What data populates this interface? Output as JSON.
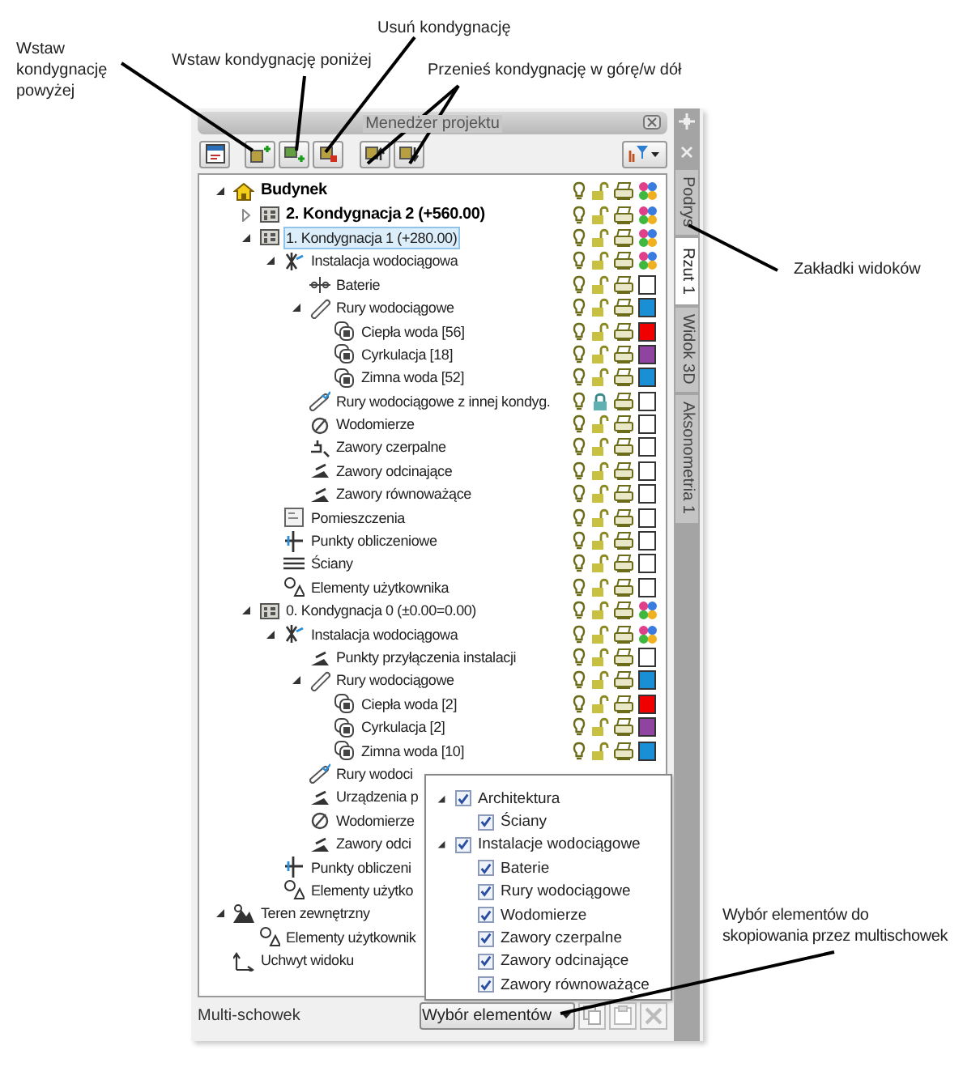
{
  "annotations": [
    {
      "lines": [
        "Wstaw",
        "kondygnację",
        "powyżej"
      ]
    },
    {
      "lines": [
        "Wstaw kondygnację poniżej"
      ]
    },
    {
      "lines": [
        "Usuń kondygnację"
      ]
    },
    {
      "lines": [
        "Przenieś kondygnację w górę/w dół"
      ]
    },
    {
      "lines": [
        "Zakładki widoków"
      ]
    },
    {
      "lines": [
        "Wybór elementów do",
        "skopiowania przez multischowek"
      ]
    }
  ],
  "panel": {
    "title": "Menedżer projektu"
  },
  "view_tabs": [
    {
      "label": "Podrys",
      "selected": false
    },
    {
      "label": "Rzut 1",
      "selected": true
    },
    {
      "label": "Widok 3D",
      "selected": false
    },
    {
      "label": "Aksonometria 1",
      "selected": false
    }
  ],
  "tree": [
    {
      "label": "Budynek",
      "kind": "building",
      "bold": true,
      "selected": false,
      "expanded": true,
      "status": {
        "locked": false,
        "multicolor": true
      },
      "children": [
        {
          "label": "2. Kondygnacja 2 (+560.00)",
          "kind": "floor",
          "bold": true,
          "selected": false,
          "expanded": false,
          "status": {
            "locked": false,
            "multicolor": true
          }
        },
        {
          "label": "1. Kondygnacja 1 (+280.00)",
          "kind": "floor",
          "selected": true,
          "expanded": true,
          "status": {
            "locked": false,
            "multicolor": true
          },
          "children": [
            {
              "label": "Instalacja wodociągowa",
              "kind": "installation",
              "selected": false,
              "expanded": true,
              "status": {
                "locked": false,
                "multicolor": true
              },
              "children": [
                {
                  "label": "Baterie",
                  "kind": "fixture",
                  "selected": false,
                  "status": {
                    "locked": false,
                    "color": "#ffffff"
                  }
                },
                {
                  "label": "Rury wodociągowe",
                  "kind": "pipes",
                  "selected": false,
                  "expanded": true,
                  "status": {
                    "locked": false,
                    "color": "#1b8fd6"
                  },
                  "children": [
                    {
                      "label": "Ciepła woda [56]",
                      "kind": "pipe-group",
                      "selected": false,
                      "status": {
                        "locked": false,
                        "color": "#f00000"
                      }
                    },
                    {
                      "label": "Cyrkulacja [18]",
                      "kind": "pipe-group",
                      "selected": false,
                      "status": {
                        "locked": false,
                        "color": "#8e44a0"
                      }
                    },
                    {
                      "label": "Zimna woda [52]",
                      "kind": "pipe-group",
                      "selected": false,
                      "status": {
                        "locked": false,
                        "color": "#1b8fd6"
                      }
                    }
                  ]
                },
                {
                  "label": "Rury wodociągowe z innej kondyg.",
                  "kind": "pipes-other",
                  "selected": false,
                  "status": {
                    "locked": true,
                    "color": "#ffffff"
                  }
                },
                {
                  "label": "Wodomierze",
                  "kind": "meter",
                  "selected": false,
                  "status": {
                    "locked": false,
                    "color": "#ffffff"
                  }
                },
                {
                  "label": "Zawory czerpalne",
                  "kind": "tap",
                  "selected": false,
                  "status": {
                    "locked": false,
                    "color": "#ffffff"
                  }
                },
                {
                  "label": "Zawory odcinające",
                  "kind": "valve",
                  "selected": false,
                  "status": {
                    "locked": false,
                    "color": "#ffffff"
                  }
                },
                {
                  "label": "Zawory równoważące",
                  "kind": "valve",
                  "selected": false,
                  "status": {
                    "locked": false,
                    "color": "#ffffff"
                  }
                }
              ]
            },
            {
              "label": "Pomieszczenia",
              "kind": "room",
              "selected": false,
              "status": {
                "locked": false,
                "color": "#ffffff"
              }
            },
            {
              "label": "Punkty obliczeniowe",
              "kind": "points",
              "selected": false,
              "status": {
                "locked": false,
                "color": "#ffffff"
              }
            },
            {
              "label": "Ściany",
              "kind": "walls",
              "selected": false,
              "status": {
                "locked": false,
                "color": "#ffffff"
              }
            },
            {
              "label": "Elementy użytkownika",
              "kind": "user-elements",
              "selected": false,
              "status": {
                "locked": false,
                "color": "#ffffff"
              }
            }
          ]
        },
        {
          "label": "0. Kondygnacja 0 (±0.00=0.00)",
          "kind": "floor",
          "selected": false,
          "expanded": true,
          "status": {
            "locked": false,
            "multicolor": true
          },
          "children": [
            {
              "label": "Instalacja wodociągowa",
              "kind": "installation",
              "selected": false,
              "expanded": true,
              "status": {
                "locked": false,
                "multicolor": true
              },
              "children": [
                {
                  "label": "Punkty przyłączenia instalacji",
                  "kind": "valve",
                  "selected": false,
                  "status": {
                    "locked": false,
                    "color": "#ffffff"
                  }
                },
                {
                  "label": "Rury wodociągowe",
                  "kind": "pipes",
                  "selected": false,
                  "expanded": true,
                  "status": {
                    "locked": false,
                    "color": "#1b8fd6"
                  },
                  "children": [
                    {
                      "label": "Ciepła woda [2]",
                      "kind": "pipe-group",
                      "selected": false,
                      "status": {
                        "locked": false,
                        "color": "#f00000"
                      }
                    },
                    {
                      "label": "Cyrkulacja [2]",
                      "kind": "pipe-group",
                      "selected": false,
                      "status": {
                        "locked": false,
                        "color": "#8e44a0"
                      }
                    },
                    {
                      "label": "Zimna woda [10]",
                      "kind": "pipe-group",
                      "selected": false,
                      "status": {
                        "locked": false,
                        "color": "#1b8fd6"
                      }
                    }
                  ]
                },
                {
                  "label": "Rury wodoci",
                  "kind": "pipes-other",
                  "selected": false
                },
                {
                  "label": "Urządzenia p",
                  "kind": "valve",
                  "selected": false
                },
                {
                  "label": "Wodomierze",
                  "kind": "meter",
                  "selected": false
                },
                {
                  "label": "Zawory odci",
                  "kind": "valve",
                  "selected": false
                }
              ]
            },
            {
              "label": "Punkty obliczeni",
              "kind": "points",
              "selected": false
            },
            {
              "label": "Elementy użytko",
              "kind": "user-elements",
              "selected": false
            }
          ]
        }
      ]
    },
    {
      "label": "Teren zewnętrzny",
      "kind": "terrain",
      "selected": false,
      "expanded": true,
      "children": [
        {
          "label": "Elementy użytkownik",
          "kind": "user-elements",
          "selected": false
        }
      ]
    },
    {
      "label": "Uchwyt widoku",
      "kind": "view-handle",
      "selected": false
    }
  ],
  "element_picker": {
    "items": [
      {
        "label": "Architektura",
        "checked": true,
        "expanded": true,
        "children": [
          {
            "label": "Ściany",
            "checked": true
          }
        ]
      },
      {
        "label": "Instalacje wodociągowe",
        "checked": true,
        "expanded": true,
        "children": [
          {
            "label": "Baterie",
            "checked": true
          },
          {
            "label": "Rury wodociągowe",
            "checked": true
          },
          {
            "label": "Wodomierze",
            "checked": true
          },
          {
            "label": "Zawory czerpalne",
            "checked": true
          },
          {
            "label": "Zawory odcinające",
            "checked": true
          },
          {
            "label": "Zawory równoważące",
            "checked": true
          }
        ]
      }
    ]
  },
  "clipboard": {
    "label": "Multi-schowek",
    "button": "Wybór elementów"
  }
}
